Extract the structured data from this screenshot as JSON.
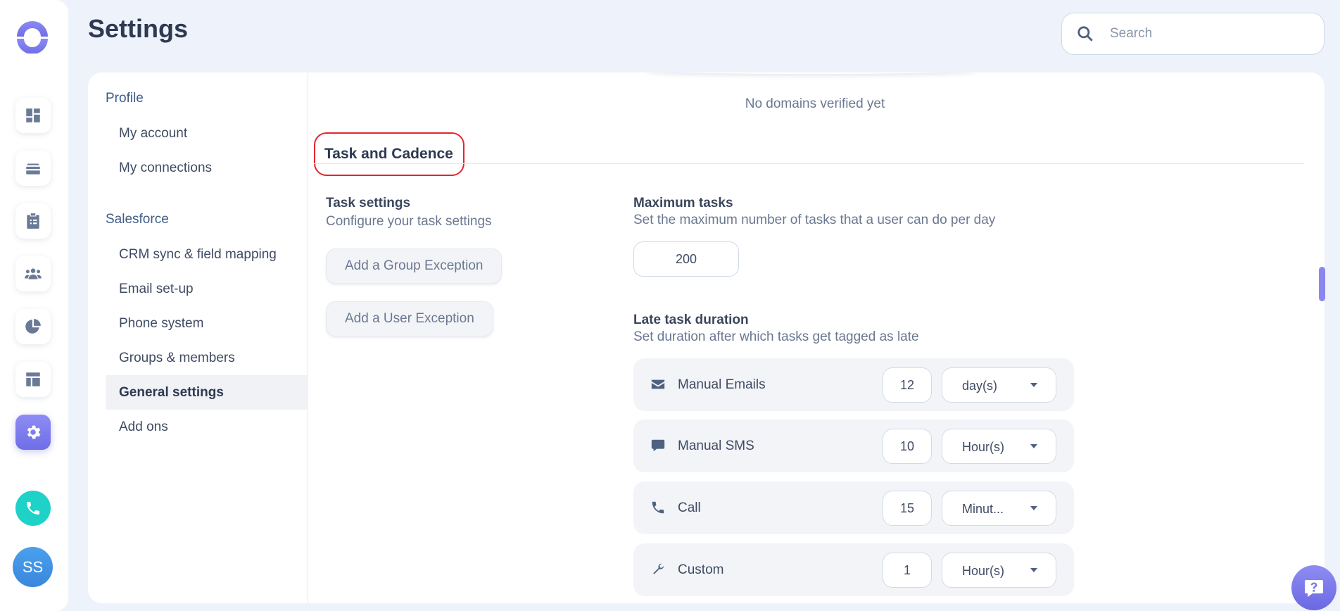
{
  "page": {
    "title": "Settings"
  },
  "search": {
    "placeholder": "Search"
  },
  "rail": {
    "items": [
      {
        "icon": "dashboard-icon"
      },
      {
        "icon": "stack-icon"
      },
      {
        "icon": "clipboard-icon"
      },
      {
        "icon": "team-icon"
      },
      {
        "icon": "pie-chart-icon"
      },
      {
        "icon": "layout-icon"
      },
      {
        "icon": "gear-icon",
        "active": true
      }
    ],
    "avatar_initials": "SS",
    "accent": "#7b79ec",
    "phone_color": "#1ed2c7"
  },
  "subnav": {
    "sections": [
      {
        "title": "Profile",
        "items": [
          "My account",
          "My connections"
        ]
      },
      {
        "title": "Salesforce",
        "items": [
          "CRM sync & field mapping",
          "Email set-up",
          "Phone system",
          "Groups & members",
          "General settings",
          "Add ons"
        ]
      }
    ],
    "active_item": "General settings"
  },
  "content": {
    "no_domains": "No domains verified yet",
    "section_title": "Task and Cadence",
    "task_settings": {
      "title": "Task settings",
      "desc": "Configure your task settings",
      "buttons": [
        "Add a Group Exception",
        "Add a User Exception"
      ]
    },
    "max_tasks": {
      "title": "Maximum tasks",
      "desc": "Set the maximum number of tasks that a user can do per day",
      "value": "200"
    },
    "late_duration": {
      "title": "Late task duration",
      "desc": "Set duration after which tasks get tagged as late",
      "rows": [
        {
          "icon": "mail-icon",
          "label": "Manual Emails",
          "value": "12",
          "unit": "day(s)"
        },
        {
          "icon": "chat-bubble-icon",
          "label": "Manual SMS",
          "value": "10",
          "unit": "Hour(s)"
        },
        {
          "icon": "phone-icon",
          "label": "Call",
          "value": "15",
          "unit": "Minut..."
        },
        {
          "icon": "wrench-icon",
          "label": "Custom",
          "value": "1",
          "unit": "Hour(s)"
        }
      ]
    }
  }
}
